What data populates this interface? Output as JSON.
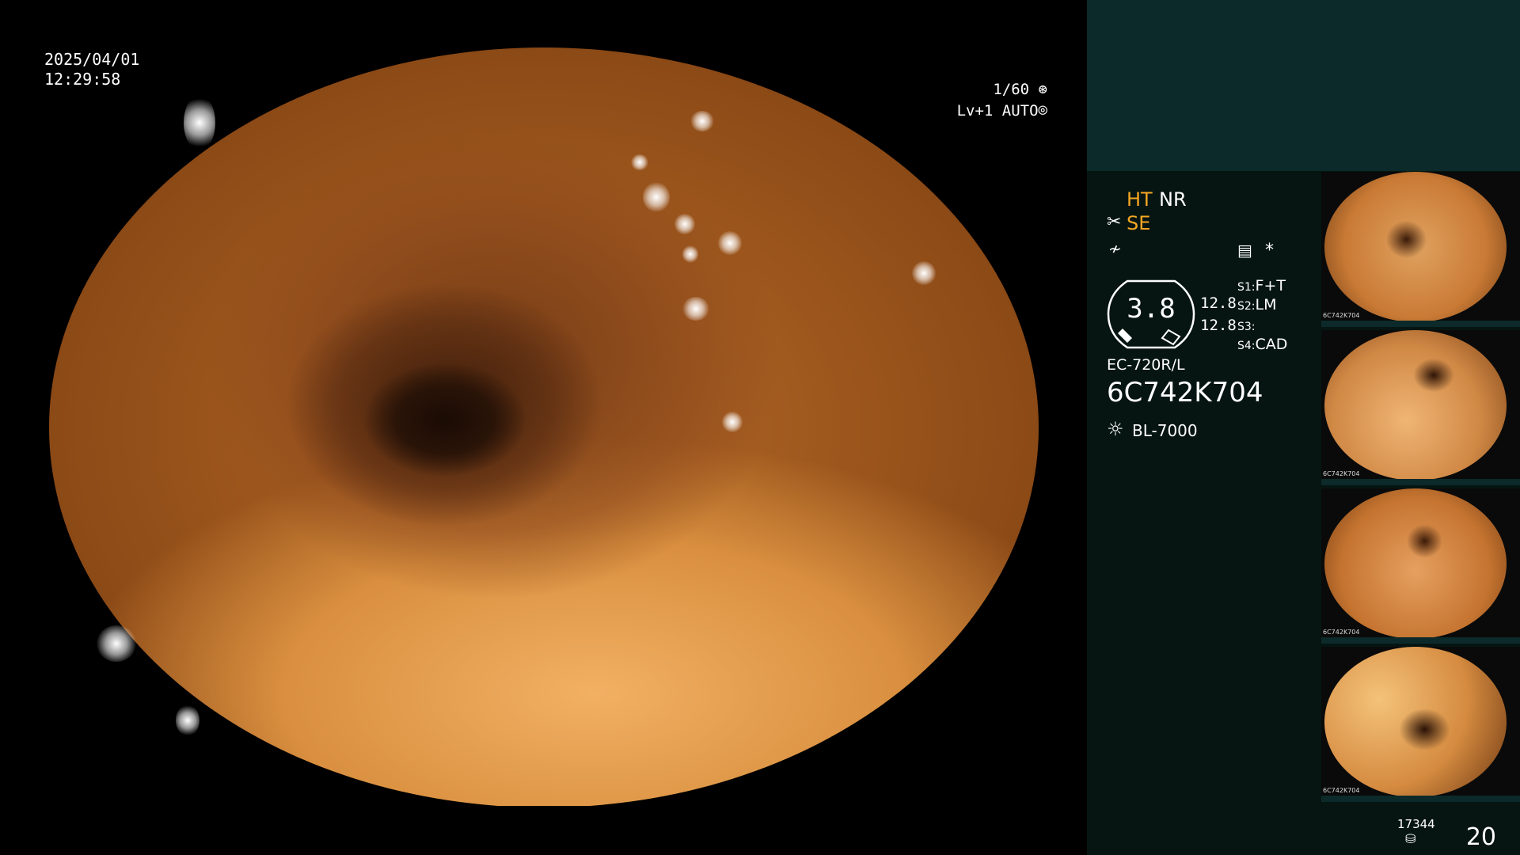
{
  "overlay": {
    "date": "2025/04/01",
    "time": "12:29:58",
    "shutter": "1/60",
    "shutter_icon": "aperture-icon",
    "level": "Lv+1",
    "auto": "AUTO",
    "auto_icon": "iris-icon"
  },
  "panel": {
    "mode1": "HT",
    "mode2": "NR",
    "mode3": "SE",
    "record_icon_symbol": "*",
    "gauge_value": "3.8",
    "value_a": "12.8",
    "value_b": "12.8",
    "s1_label": "S1:",
    "s1_value": "F+T",
    "s2_label": "S2:",
    "s2_value": "LM",
    "s3_label": "S3:",
    "s3_value": "",
    "s4_label": "S4:",
    "s4_value": "CAD",
    "scope_model": "EC-720R/L",
    "serial": "6C742K704",
    "light_source": "BL-7000"
  },
  "thumb_labels": [
    "6C742K704",
    "6C742K704",
    "6C742K704",
    "6C742K704"
  ],
  "footer": {
    "image_count": "17344",
    "page_number": "20"
  },
  "colors": {
    "accent": "#f5a623",
    "panel_bg": "#061512",
    "panel_top": "#0b2a29"
  }
}
